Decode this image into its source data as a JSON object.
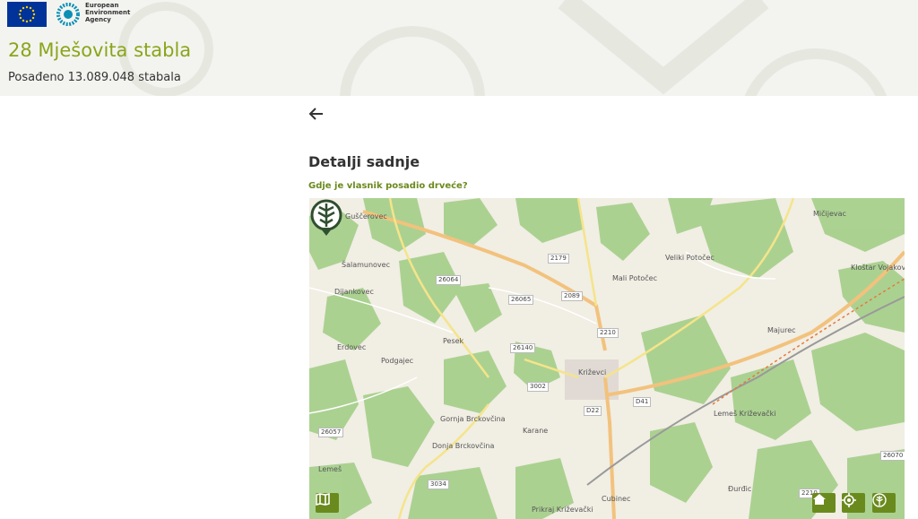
{
  "header": {
    "eea_name": "European Environment Agency",
    "title": "28 Mješovita stabla",
    "planted": "Posađeno 13.089.048 stabala"
  },
  "main": {
    "section_title": "Detalji sadnje",
    "question": "Gdje je vlasnik posadio drveće?"
  },
  "map": {
    "places": [
      "Guščerovec",
      "Šalamunovec",
      "Dijankovec",
      "Erdovec",
      "Podgajec",
      "Pesek",
      "Križevci",
      "Gornja Brckovčina",
      "Donja Brckovčina",
      "Karane",
      "Lemeš",
      "Prikraj Križevački",
      "Cubinec",
      "Đurđic",
      "Lemeš Križevački",
      "Majurec",
      "Veliki Potočec",
      "Mali Potočec",
      "Mičijevac",
      "Kloštar Vojakovački"
    ],
    "roads": [
      "26064",
      "26065",
      "2179",
      "2089",
      "2210",
      "26140",
      "3002",
      "D22",
      "D41",
      "26057",
      "3034",
      "26070",
      "2210"
    ]
  },
  "colors": {
    "accent": "#8aa51b",
    "button": "#6b8a1e",
    "forest": "#a8d08d",
    "map_bg": "#f1eee4"
  },
  "icons": [
    "eu-flag-icon",
    "eea-logo-icon",
    "back-arrow-icon",
    "map-layers-icon",
    "home-icon",
    "locate-icon",
    "tree-icon",
    "tree-pin-icon"
  ]
}
